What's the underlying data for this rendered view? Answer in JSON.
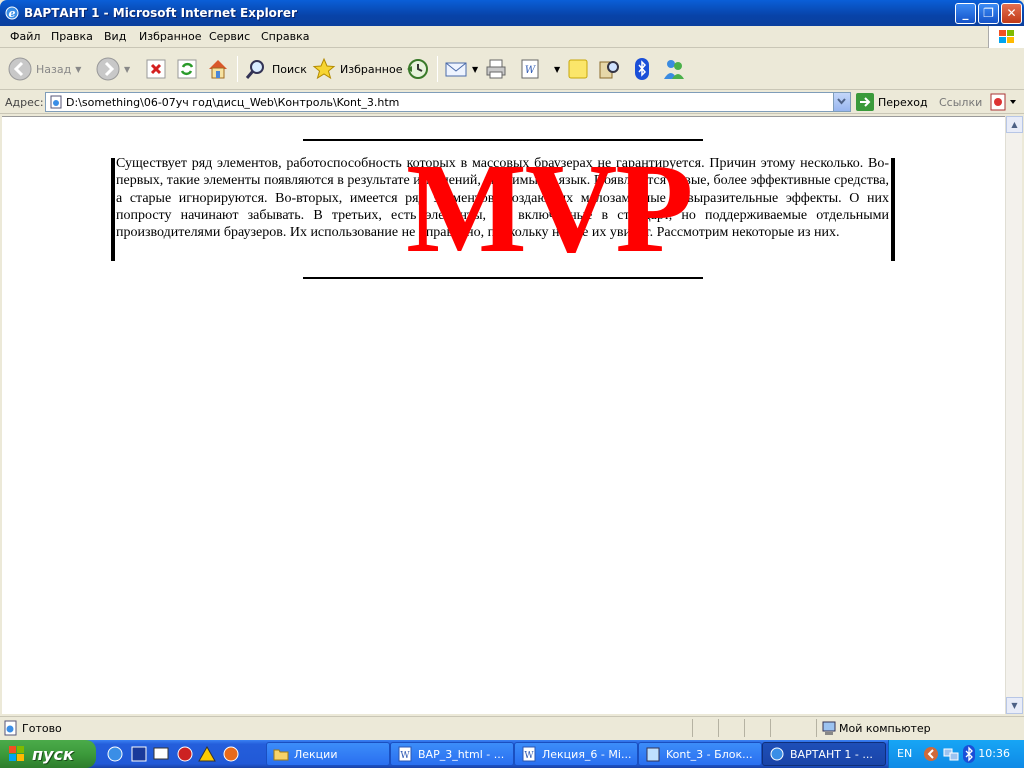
{
  "window": {
    "title": "ВАРТАНТ 1 - Microsoft Internet Explorer",
    "controls": {
      "minimize": "_",
      "maximize": "❐",
      "close": "✕"
    }
  },
  "menu": [
    "Файл",
    "Правка",
    "Вид",
    "Избранное",
    "Сервис",
    "Справка"
  ],
  "toolbar": {
    "back_label": "Назад",
    "search_label": "Поиск",
    "favorites_label": "Избранное"
  },
  "address": {
    "label": "Адрес:",
    "url": "D:\\something\\06-07уч год\\дисц_Web\\Контроль\\Kont_3.htm",
    "go_label": "Переход",
    "links_label": "Ссылки"
  },
  "page": {
    "paragraph": "Существует ряд элементов, работоспособность которых в массовых браузерах не гарантируется. Причин этому несколько. Во-первых, такие элементы появляются в результате изменений, вносимых в язык. Появляются новые, более эффективные средства, а старые игнорируются. Во-вторых, имеется ряд элементов, создающих малозаметные невыразительные эффекты. О них попросту начинают забывать. В третьих, есть элементы, не включенные в стандарт, но поддерживаемые отдельными производителями браузеров. Их использование не оправдано, поскольку не все их увидят. Рассмотрим некоторые из них.",
    "overlay_text": "MVP",
    "overlay_color": "#ff0000"
  },
  "status": {
    "text": "Готово",
    "zone": "Мой компьютер"
  },
  "taskbar": {
    "start_label": "пуск",
    "tasks": [
      "Лекции",
      "ВАР_3_html - ...",
      "Лекция_6 - Mi...",
      "Kont_3 - Блок...",
      "ВАРТАНТ 1 - ..."
    ],
    "lang": "EN",
    "clock": "10:36"
  },
  "colors": {
    "titlebar": "#0a5fd8",
    "taskbar": "#245edb",
    "start": "#3c9a3b"
  }
}
